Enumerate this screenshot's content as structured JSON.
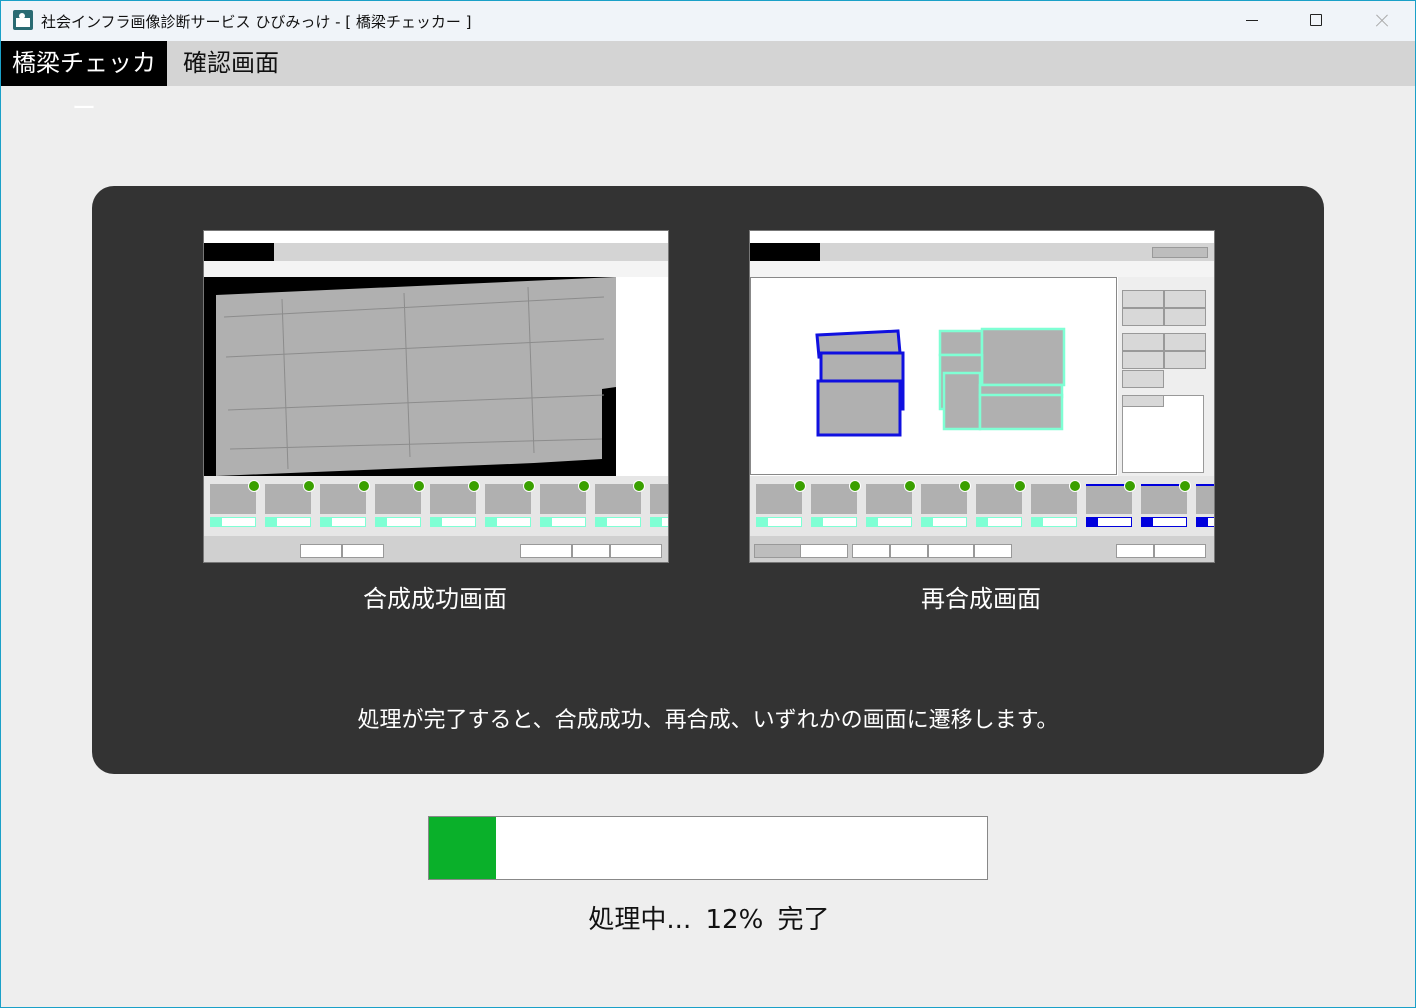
{
  "window": {
    "title": "社会インフラ画像診断サービス ひびみっけ - [ 橋梁チェッカー ]"
  },
  "tabs": {
    "app_label": "橋梁チェッカー",
    "page_label": "確認画面"
  },
  "panel": {
    "left_caption": "合成成功画面",
    "right_caption": "再合成画面",
    "message": "処理が完了すると、合成成功、再合成、いずれかの画面に遷移します。"
  },
  "progress": {
    "percent": 12,
    "prefix": "処理中...",
    "percent_text": "12%",
    "suffix": "完了",
    "fill_color": "#0ab02a"
  }
}
